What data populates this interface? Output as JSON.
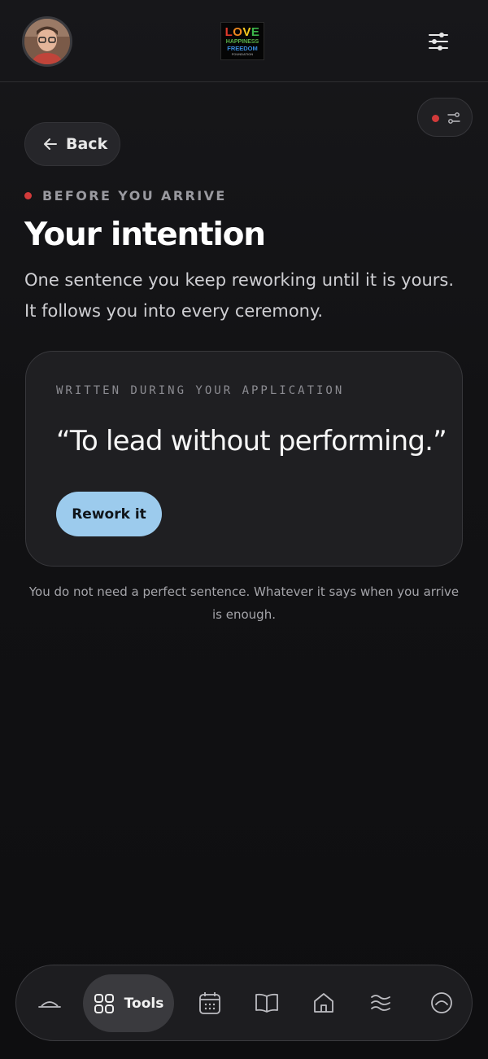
{
  "header": {
    "avatar_alt": "profile photo",
    "logo": {
      "line1": [
        "L",
        "O",
        "V",
        "E"
      ],
      "line2": "HAPPINESS",
      "line3": "FREEDOM",
      "line4": "FOUNDATION"
    }
  },
  "back": {
    "label": "Back"
  },
  "eyebrow": "BEFORE YOU ARRIVE",
  "title": "Your intention",
  "subtitle": "One sentence you keep reworking until it is yours. It follows you into every ceremony.",
  "card": {
    "meta": "WRITTEN DURING YOUR APPLICATION",
    "quote": "“To lead without performing.”",
    "button": "Rework it"
  },
  "note": "You do not need a perfect sentence. Whatever it says when you arrive is enough.",
  "nav": {
    "active_label": "Tools",
    "items": [
      "horizon-icon",
      "tools-icon",
      "calendar-icon",
      "book-icon",
      "home-icon",
      "waves-icon",
      "gauge-icon"
    ]
  },
  "colors": {
    "accent_dot": "#d23a3a",
    "button_bg": "#9ccbed",
    "background": "#111113"
  }
}
